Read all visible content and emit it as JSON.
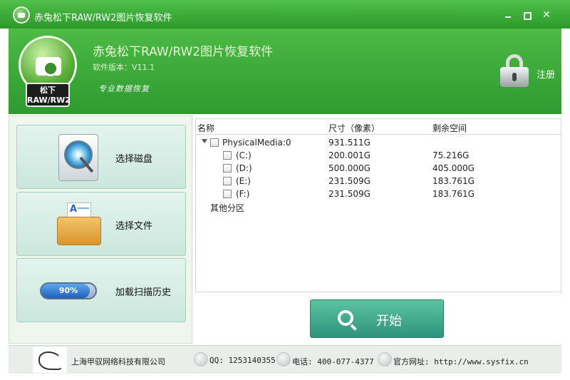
{
  "window": {
    "title": "赤兔松下RAW/RW2图片恢复软件",
    "controls": [
      "minimize",
      "maximize",
      "close"
    ]
  },
  "header": {
    "logo": {
      "top": "松下",
      "bottom": "RAW/RW2"
    },
    "app_name": "赤兔松下RAW/RW2图片恢复软件",
    "version": "软件版本：V11.1",
    "slogan": "专业数据恢复",
    "register_label": "注册"
  },
  "sidebar": {
    "items": [
      {
        "label": "选择磁盘",
        "icon": "hard-disk-icon"
      },
      {
        "label": "选择文件",
        "icon": "folder-icon"
      },
      {
        "label": "加载扫描历史",
        "icon": "progress-icon",
        "progress": "90%",
        "progress_value": 90
      }
    ]
  },
  "table": {
    "headers": [
      "名称",
      "尺寸（像素）",
      "剩余空间"
    ],
    "rows": [
      {
        "name": "PhysicalMedia:0",
        "size": "931.511G",
        "free": ""
      },
      {
        "name": "(C:)",
        "size": "200.001G",
        "free": "75.216G"
      },
      {
        "name": "(D:)",
        "size": "500.000G",
        "free": "405.000G"
      },
      {
        "name": "(E:)",
        "size": "231.509G",
        "free": "183.761G"
      },
      {
        "name": "(F:)",
        "size": "231.509G",
        "free": "183.761G"
      }
    ],
    "other_partitions": "其他分区"
  },
  "start_button": {
    "label": "开始"
  },
  "footer": {
    "company": "上海甲驭网络科技有限公司",
    "qq": "QQ: 1253140355",
    "phone": "电话: 400-077-4377",
    "website": "官方网址: http://www.sysfix.cn"
  },
  "colors": {
    "header_green": "#3aab38",
    "button_teal": "#45ad8d",
    "panel_bg": "#eef6ee"
  }
}
